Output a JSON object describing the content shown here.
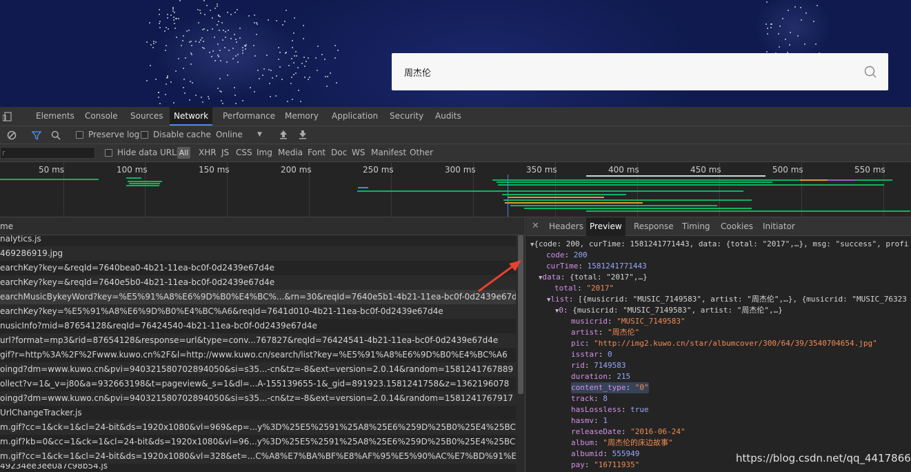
{
  "site": {
    "search_value": "周杰伦"
  },
  "devtools": {
    "tabs": [
      "Elements",
      "Console",
      "Sources",
      "Network",
      "Performance",
      "Memory",
      "Application",
      "Security",
      "Audits"
    ],
    "active_tab": "Network",
    "toolbar": {
      "preserve_log": "Preserve log",
      "disable_cache": "Disable cache",
      "throttle": "Online"
    },
    "filter": {
      "placeholder": "r",
      "hide_data_urls": "Hide data URLs",
      "all_label": "All",
      "types": [
        "XHR",
        "JS",
        "CSS",
        "Img",
        "Media",
        "Font",
        "Doc",
        "WS",
        "Manifest",
        "Other"
      ]
    },
    "timeline": {
      "ticks": [
        "50 ms",
        "100 ms",
        "150 ms",
        "200 ms",
        "250 ms",
        "300 ms",
        "350 ms",
        "400 ms",
        "450 ms",
        "500 ms",
        "550 ms"
      ]
    },
    "requests": {
      "header": "me",
      "rows": [
        "nalytics.js",
        "469286919.jpg",
        "earchKey?key=&reqId=7640bea0-4b21-11ea-bc0f-0d2439e67d4e",
        "earchKey?key=&reqId=7640e5b0-4b21-11ea-bc0f-0d2439e67d4e",
        "earchMusicBykeyWord?key=%E5%91%A8%E6%9D%B0%E4%BC%...&rn=30&reqId=7640e5b1-4b21-11ea-bc0f-0d2439e67d4e",
        "earchKey?key=%E5%91%A8%E6%9D%B0%E4%BC%A6&reqId=7641d010-4b21-11ea-bc0f-0d2439e67d4e",
        "nusicInfo?mid=87654128&reqId=76424540-4b21-11ea-bc0f-0d2439e67d4e",
        "url?format=mp3&rid=87654128&response=url&type=conv...767827&reqId=76424541-4b21-11ea-bc0f-0d2439e67d4e",
        "gif?r=http%3A%2F%2Fwww.kuwo.cn%2F&l=http://www.kuwo.cn/search/list?key=%E5%91%A8%E6%9D%B0%E4%BC%A6",
        "oingd?dm=www.kuwo.cn&pvi=940321580702894050&si=s35...-cn&tz=-8&ext=version=2.0.14&random=1581241767889",
        "ollect?v=1&_v=j80&a=932663198&t=pageview&_s=1&dl=...A-155139655-1&_gid=891923.1581241758&z=1362196078",
        "oingd?dm=www.kuwo.cn&pvi=940321580702894050&si=s35...-cn&tz=-8&ext=version=2.0.14&random=1581241767917",
        "UrlChangeTracker.js",
        "m.gif?cc=1&ck=1&cl=24-bit&ds=1920x1080&vl=969&ep=...y%3D%25E5%2591%25A8%25E6%259D%25B0%25E4%25BC%25A6",
        "m.gif?kb=0&cc=1&ck=1&cl=24-bit&ds=1920x1080&vl=96...y%3D%25E5%2591%25A8%25E6%259D%25B0%25E4%25BC%25A6",
        "m.gif?cc=1&ck=1&cl=24-bit&ds=1920x1080&vl=328&et=...C%A8%E7%BA%BF%E8%AF%95%E5%90%AC%E7%BD%91%E7%AB%99",
        "49234ee3ee0a7c98b54.js"
      ]
    },
    "details": {
      "tabs": [
        "Headers",
        "Preview",
        "Response",
        "Timing",
        "Cookies",
        "Initiator"
      ],
      "active_tab": "Preview",
      "json_root": "{code: 200, curTime: 1581241771443, data: {total: \"2017\",…}, msg: \"success\", profi",
      "code_key": "code",
      "code_val": "200",
      "curtime_key": "curTime",
      "curtime_val": "1581241771443",
      "data_key": "data",
      "data_summary": "{total: \"2017\",…}",
      "total_key": "total",
      "total_val": "\"2017\"",
      "list_key": "list",
      "list_summary": "[{musicrid: \"MUSIC_7149583\", artist: \"周杰伦\",…}, {musicrid: \"MUSIC_76323",
      "item0_key": "0",
      "item0_summary": "{musicrid: \"MUSIC_7149583\", artist: \"周杰伦\",…}",
      "fields": [
        {
          "key": "musicrid",
          "val": "\"MUSIC_7149583\"",
          "kind": "s"
        },
        {
          "key": "artist",
          "val": "\"周杰伦\"",
          "kind": "s"
        },
        {
          "key": "pic",
          "val": "\"http://img2.kuwo.cn/star/albumcover/300/64/39/3540704654.jpg\"",
          "kind": "s"
        },
        {
          "key": "isstar",
          "val": "0",
          "kind": "n"
        },
        {
          "key": "rid",
          "val": "7149583",
          "kind": "n"
        },
        {
          "key": "duration",
          "val": "215",
          "kind": "n"
        },
        {
          "key": "content_type",
          "val": "\"0\"",
          "kind": "s"
        },
        {
          "key": "track",
          "val": "8",
          "kind": "n"
        },
        {
          "key": "hasLossless",
          "val": "true",
          "kind": "n"
        },
        {
          "key": "hasmv",
          "val": "1",
          "kind": "n"
        },
        {
          "key": "releaseDate",
          "val": "\"2016-06-24\"",
          "kind": "s"
        },
        {
          "key": "album",
          "val": "\"周杰伦的床边故事\"",
          "kind": "s"
        },
        {
          "key": "albumid",
          "val": "555949",
          "kind": "n"
        },
        {
          "key": "pay",
          "val": "\"16711935\"",
          "kind": "s"
        }
      ]
    }
  },
  "watermark": "https://blog.csdn.net/qq_44178666"
}
